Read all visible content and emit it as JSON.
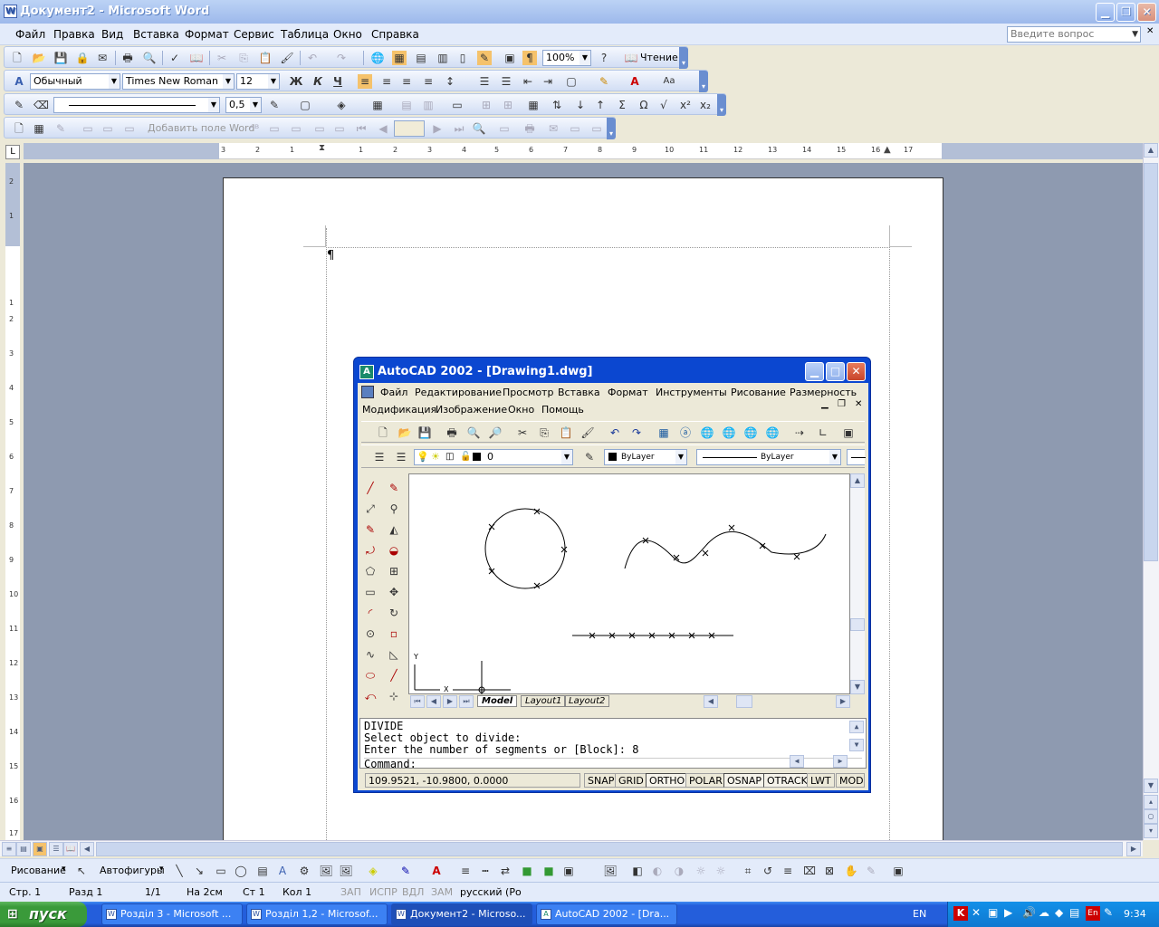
{
  "word": {
    "title": "Документ2 - Microsoft Word",
    "menu": [
      "Файл",
      "Правка",
      "Вид",
      "Вставка",
      "Формат",
      "Сервис",
      "Таблица",
      "Окно",
      "Справка"
    ],
    "ask_placeholder": "Введите вопрос",
    "zoom": "100%",
    "read_label": "Чтение",
    "style": "Обычный",
    "font": "Times New Roman",
    "size": "12",
    "bold": "Ж",
    "italic": "К",
    "underline": "Ч",
    "line_width": "0,5",
    "add_field": "Добавить поле Word",
    "ruler_h": [
      "3",
      "2",
      "1",
      "1",
      "2",
      "3",
      "4",
      "5",
      "6",
      "7",
      "8",
      "9",
      "10",
      "11",
      "12",
      "13",
      "14",
      "15",
      "16",
      "17"
    ],
    "ruler_v": [
      "2",
      "1",
      "1",
      "2",
      "3",
      "4",
      "5",
      "6",
      "7",
      "8",
      "9",
      "10",
      "11",
      "12",
      "13",
      "14",
      "15",
      "16",
      "17"
    ],
    "ruler_tab": "L",
    "pilcrow": "¶",
    "drawing_label": "Рисование",
    "autoshapes_label": "Автофигуры",
    "status": {
      "page": "Стр. 1",
      "section": "Разд 1",
      "pages": "1/1",
      "at": "На 2см",
      "line": "Ст 1",
      "col": "Кол 1",
      "rec": "ЗАП",
      "trk": "ИСПР",
      "ext": "ВДЛ",
      "ovr": "ЗАМ",
      "lang": "русский (Ро"
    }
  },
  "acad": {
    "title": "AutoCAD 2002 - [Drawing1.dwg]",
    "menu1": [
      "Файл",
      "Редактирование",
      "Просмотр",
      "Вставка",
      "Формат",
      "Инструменты",
      "Рисование",
      "Размерность"
    ],
    "menu2": [
      "Модификация",
      "Изображение",
      "Окно",
      "Помощь"
    ],
    "layer": "0",
    "color": "ByLayer",
    "linetype": "ByLayer",
    "tabs": [
      "Model",
      "Layout1",
      "Layout2"
    ],
    "axis_x": "X",
    "axis_y": "Y",
    "cmd_lines": [
      "DIVIDE",
      "Select object to divide:",
      "Enter the number of segments or [Block]: 8",
      "Command:"
    ],
    "coords": "109.9521, -10.9800, 0.0000",
    "modes": [
      "SNAP",
      "GRID",
      "ORTHO",
      "POLAR",
      "OSNAP",
      "OTRACK",
      "LWT",
      "MODE"
    ]
  },
  "taskbar": {
    "start": "пуск",
    "tasks": [
      "Розділ 3 - Microsoft ...",
      "Розділ 1,2 - Microsof...",
      "Документ2 - Microso...",
      "AutoCAD 2002 - [Dra..."
    ],
    "lang": "EN",
    "clock": "9:34"
  }
}
